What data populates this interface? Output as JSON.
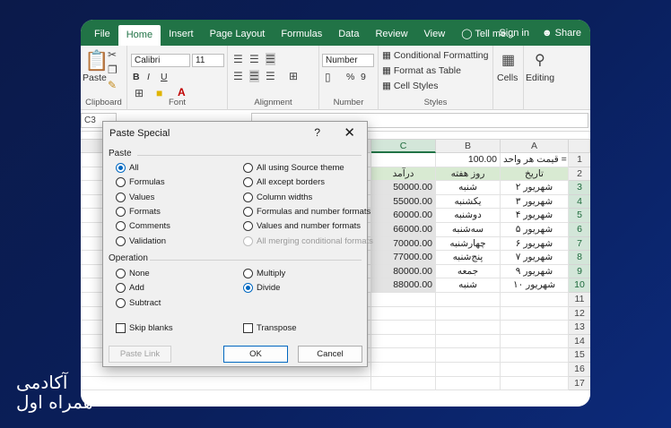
{
  "ribbon": {
    "tabs": [
      "File",
      "Home",
      "Insert",
      "Page Layout",
      "Formulas",
      "Data",
      "Review",
      "View"
    ],
    "active_tab": "Home",
    "tell_me": "Tell me...",
    "sign_in": "Sign in",
    "share": "Share",
    "clipboard": {
      "paste": "Paste",
      "label": "Clipboard"
    },
    "font": {
      "name": "Calibri",
      "size": "11",
      "label": "Font",
      "bold": "B",
      "italic": "I",
      "underline": "U"
    },
    "alignment": {
      "label": "Alignment"
    },
    "number": {
      "format": "Number",
      "label": "Number",
      "percent": "%",
      "comma": "9"
    },
    "styles": {
      "conditional": "Conditional Formatting",
      "table": "Format as Table",
      "cell": "Cell Styles",
      "label": "Styles"
    },
    "cells": {
      "label": "Cells"
    },
    "editing": {
      "label": "Editing"
    }
  },
  "formula_bar": {
    "name_box": "C3",
    "value": ""
  },
  "sheet": {
    "columns": [
      "C",
      "B",
      "A"
    ],
    "rows": [
      "1",
      "2",
      "3",
      "4",
      "5",
      "6",
      "7",
      "8",
      "9",
      "10",
      "11",
      "12",
      "13",
      "14",
      "15",
      "16",
      "17"
    ],
    "price_label": "قیمت هر واحد =",
    "price_value": "100.00",
    "headers": {
      "a": "تاریخ",
      "b": "روز هفته",
      "c": "درآمد"
    },
    "data": [
      {
        "a": "۲ شهریور",
        "b": "شنبه",
        "c": "50000.00"
      },
      {
        "a": "۳ شهریور",
        "b": "یکشنبه",
        "c": "55000.00"
      },
      {
        "a": "۴ شهریور",
        "b": "دوشنبه",
        "c": "60000.00"
      },
      {
        "a": "۵ شهریور",
        "b": "سه‌شنبه",
        "c": "66000.00"
      },
      {
        "a": "۶ شهریور",
        "b": "چهارشنبه",
        "c": "70000.00"
      },
      {
        "a": "۷ شهریور",
        "b": "پنج‌شنبه",
        "c": "77000.00"
      },
      {
        "a": "۹ شهریور",
        "b": "جمعه",
        "c": "80000.00"
      },
      {
        "a": "۱۰ شهریور",
        "b": "شنبه",
        "c": "88000.00"
      }
    ]
  },
  "dialog": {
    "title": "Paste Special",
    "help": "?",
    "close": "✕",
    "paste_section": "Paste",
    "paste_options_left": [
      "All",
      "Formulas",
      "Values",
      "Formats",
      "Comments",
      "Validation"
    ],
    "paste_options_right": [
      "All using Source theme",
      "All except borders",
      "Column widths",
      "Formulas and number formats",
      "Values and number formats",
      "All merging conditional formats"
    ],
    "selected_paste": "All",
    "operation_section": "Operation",
    "operation_left": [
      "None",
      "Add",
      "Subtract"
    ],
    "operation_right": [
      "Multiply",
      "Divide"
    ],
    "selected_operation": "Divide",
    "skip_blanks": "Skip blanks",
    "transpose": "Transpose",
    "paste_link": "Paste Link",
    "ok": "OK",
    "cancel": "Cancel"
  },
  "brand": {
    "line1": "آکادمی",
    "line2": "همراه اول"
  },
  "colors": {
    "excel_green": "#217346",
    "background": "#0b1a4a",
    "accent_blue": "#0067c0"
  }
}
